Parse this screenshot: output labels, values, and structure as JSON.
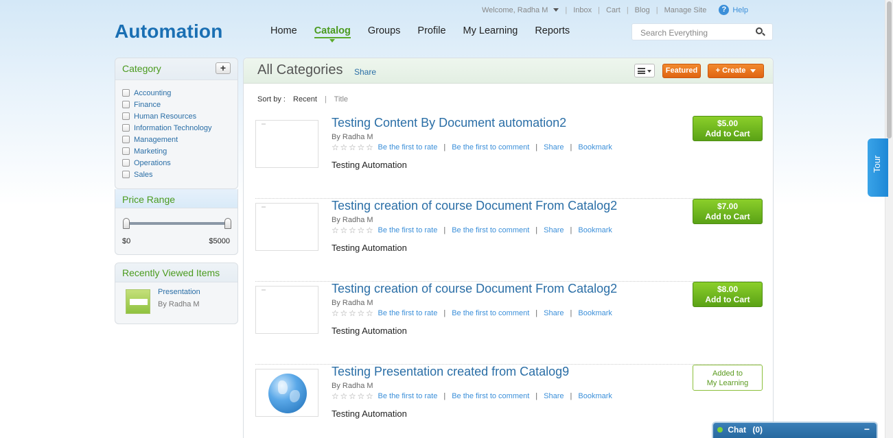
{
  "header": {
    "logo": "Automation",
    "welcome": "Welcome, Radha M",
    "util_links": [
      "Inbox",
      "Cart",
      "Blog",
      "Manage Site"
    ],
    "help": "Help",
    "nav": [
      "Home",
      "Catalog",
      "Groups",
      "Profile",
      "My Learning",
      "Reports"
    ],
    "active_nav": "Catalog",
    "search_placeholder": "Search Everything"
  },
  "sidebar": {
    "category_title": "Category",
    "add_label": "+",
    "categories": [
      "Accounting",
      "Finance",
      "Human Resources",
      "Information Technology",
      "Management",
      "Marketing",
      "Operations",
      "Sales"
    ],
    "price_title": "Price Range",
    "price_min": "$0",
    "price_max": "$5000",
    "recent_title": "Recently Viewed Items",
    "recent_item": {
      "title": "Presentation",
      "author": "By Radha M"
    }
  },
  "main": {
    "title": "All Categories",
    "share": "Share",
    "featured": "Featured",
    "create": "+ Create",
    "sort_label": "Sort by :",
    "sort_recent": "Recent",
    "sort_title": "Title",
    "rate_text": "Be the first to rate",
    "comment_text": "Be the first to comment",
    "share_text": "Share",
    "bookmark_text": "Bookmark",
    "items": [
      {
        "title": "Testing Content By Document automation2",
        "author": "By Radha M",
        "desc": "Testing Automation",
        "price": "$5.00",
        "action": "Add to Cart"
      },
      {
        "title": "Testing creation of course Document From Catalog2",
        "author": "By Radha M",
        "desc": "Testing Automation",
        "price": "$7.00",
        "action": "Add to Cart"
      },
      {
        "title": "Testing creation of course Document From Catalog2",
        "author": "By Radha M",
        "desc": "Testing Automation",
        "price": "$8.00",
        "action": "Add to Cart"
      },
      {
        "title": "Testing Presentation created from Catalog9",
        "author": "By Radha M",
        "desc": "Testing Automation",
        "status_line1": "Added to",
        "status_line2": "My Learning"
      }
    ]
  },
  "tour": "Tour",
  "chat": {
    "label": "Chat",
    "count": "(0)",
    "minimize": "−"
  }
}
